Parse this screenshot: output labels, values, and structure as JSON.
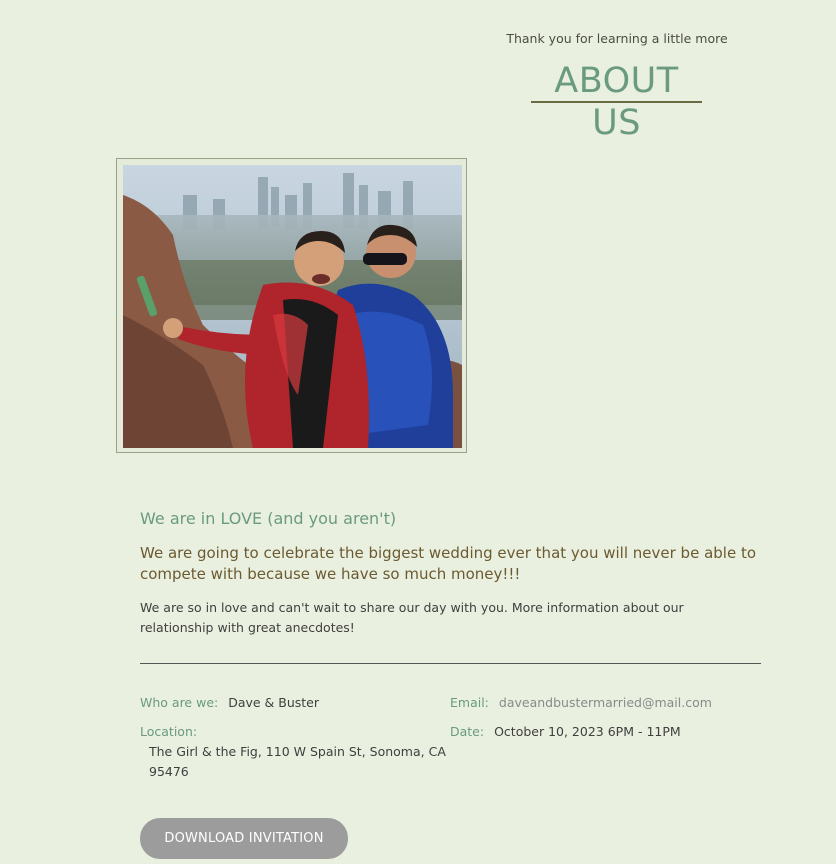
{
  "header": {
    "eyebrow": "Thank you for learning a little more",
    "title": "ABOUT US"
  },
  "photo": {
    "alt": "Dave & Buster in sequin jackets"
  },
  "intro": {
    "heading": "We are in LOVE (and you aren't)",
    "subheading": "We are going to celebrate the biggest wedding ever that you will never be able to compete with because we have so much money!!!",
    "paragraph": "We are so in love and can't wait to share our day with you. More information about our relationship with great anecdotes!"
  },
  "details": {
    "who_label": "Who are we:",
    "who_value": "Dave & Buster",
    "email_label": "Email:",
    "email_value": "daveandbustermarried@mail.com",
    "location_label": "Location:",
    "location_value": "The Girl & the Fig, 110 W Spain St, Sonoma, CA 95476",
    "date_label": "Date:",
    "date_value": "October 10, 2023 6PM - 11PM"
  },
  "actions": {
    "download_label": "DOWNLOAD INVITATION"
  },
  "colors": {
    "background": "#e9f0df",
    "accent_green": "#6a9a80",
    "accent_brown": "#6b5a32",
    "button_gray": "#9c9c9c"
  }
}
